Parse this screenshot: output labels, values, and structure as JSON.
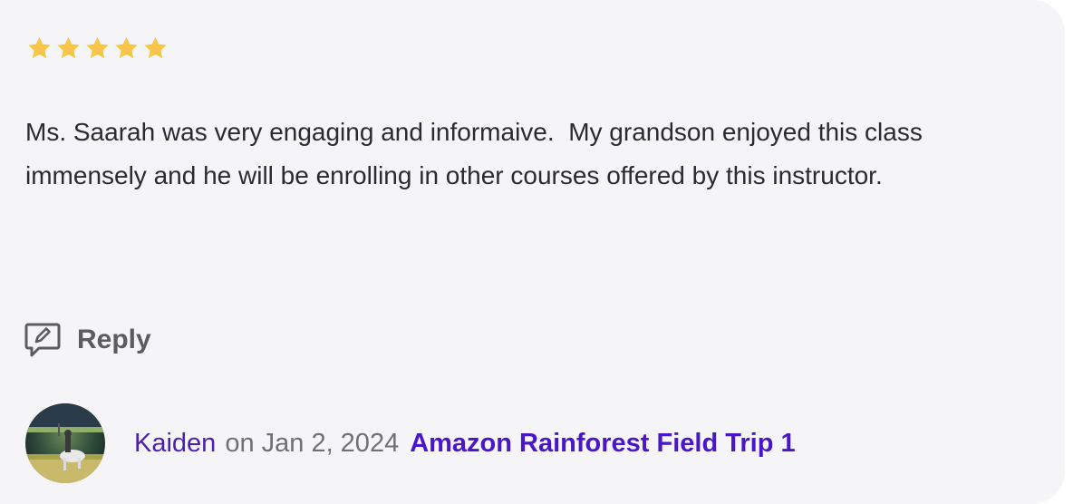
{
  "review": {
    "rating": 5,
    "rating_max": 5,
    "star_color": "#f7c548",
    "text": "Ms. Saarah was very engaging and informaive.  My grandson enjoyed this class immensely and he will be enrolling in other courses offered by this instructor.",
    "reply_label": "Reply",
    "reply_icon": "comment-edit-icon",
    "author": {
      "name": "Kaiden",
      "date_text": "on Jan 2, 2024"
    },
    "class_title": "Amazon Rainforest Field Trip 1"
  },
  "colors": {
    "card_background": "#f5f5f8",
    "link_purple": "#4a16c9",
    "muted_text": "#707070"
  }
}
